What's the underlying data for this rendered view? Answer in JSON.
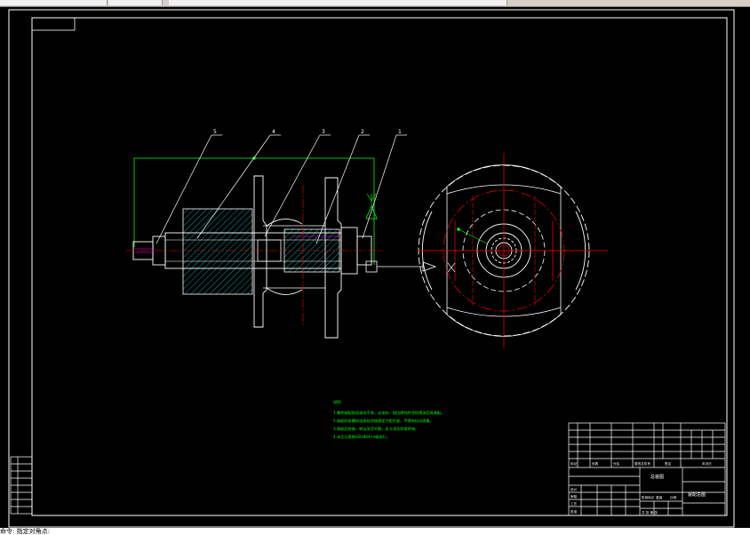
{
  "window": {
    "toolbar_labels": [
      "",
      "",
      ""
    ]
  },
  "drawing": {
    "balloons": [
      "5",
      "4",
      "3",
      "2",
      "1"
    ],
    "notes_title": "说明",
    "notes": [
      "1.零件装配前须清洗干净，去毛刺、锐边倒钝并涂防锈油后再装配。",
      "2.装配时各螺纹连接处须按规定力矩拧紧，不得有松动现象。",
      "3.装配后检查，转动灵活平稳，无卡滞及异常声响。",
      "4.未注公差按GB1804-m级执行。"
    ],
    "title_block": {
      "drawing_name": "总装图",
      "drawing_code": "装配总图",
      "headers": [
        "标记",
        "处数",
        "分区",
        "更改文件号",
        "签名",
        "年月日"
      ],
      "roles": [
        "设计",
        "审核",
        "工艺",
        "批准"
      ],
      "stage_labels": [
        "阶段标记",
        "重量",
        "比例"
      ],
      "sheet": "共  张  第  张"
    },
    "side_labels": [
      "",
      "",
      "",
      ""
    ]
  },
  "status": {
    "text": "命令: 指定对角点:"
  },
  "colors": {
    "outline": "#ffffff",
    "hatch": "#00a0a0",
    "center": "#ff0000",
    "annotation": "#00ff00",
    "thread": "#ff00ff"
  }
}
